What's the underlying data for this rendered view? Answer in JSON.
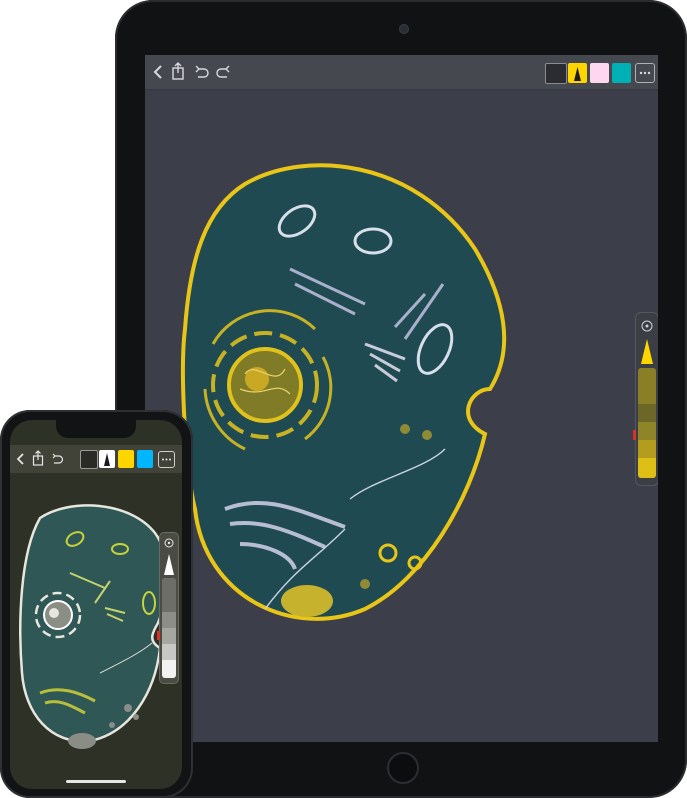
{
  "colors": {
    "ipad_canvas": "#3c3f4a",
    "cell_fill": "#1f4a52",
    "cell_outline": "#e8c517",
    "accent_yellow": "#ffd500",
    "accent_pink": "#ffd6f0",
    "accent_teal": "#00b0b4",
    "accent_blue": "#00b7ff",
    "iphone_canvas": "#2e3126",
    "iphone_cell_outline": "#e6e6dc"
  },
  "ipad": {
    "toolbar": {
      "icons": [
        "back-icon",
        "share-icon",
        "undo-icon",
        "redo-icon",
        "layers-icon",
        "pencil-tool-icon",
        "more-icon"
      ],
      "swatches": [
        "#1b1c20",
        "#ffd500",
        "#ffd6f0",
        "#00b0b4"
      ]
    }
  },
  "iphone": {
    "toolbar": {
      "icons": [
        "back-icon",
        "share-icon",
        "undo-icon",
        "layers-icon",
        "pencil-tool-icon",
        "more-icon"
      ],
      "swatches": [
        "#ffffff",
        "#ffd500",
        "#00b7ff"
      ]
    }
  }
}
